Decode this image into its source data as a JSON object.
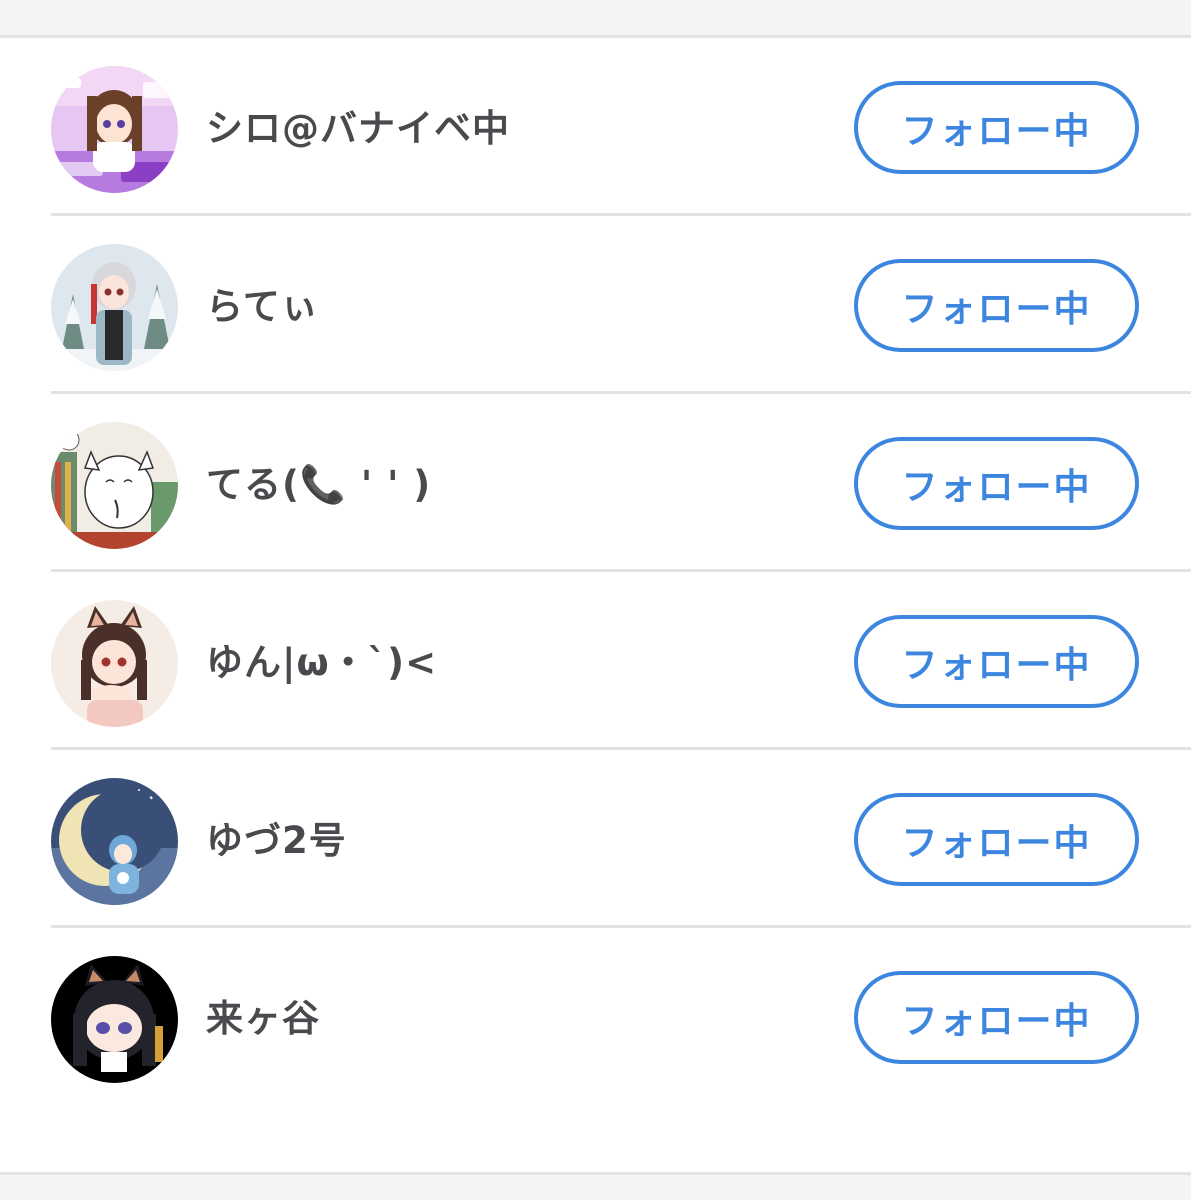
{
  "follow_list": [
    {
      "name": "シロ@バナイベ中",
      "button_label": "フォロー中",
      "avatar": "avatar-maid-girl-purple"
    },
    {
      "name": "らてぃ",
      "button_label": "フォロー中",
      "avatar": "avatar-snow-forest-girl"
    },
    {
      "name": "てる(📞 ' ' )",
      "button_label": "フォロー中",
      "avatar": "avatar-white-cat-sketch"
    },
    {
      "name": "ゆん|ω・`)<",
      "button_label": "フォロー中",
      "avatar": "avatar-cat-ear-girl"
    },
    {
      "name": "ゆづ2号",
      "button_label": "フォロー中",
      "avatar": "avatar-crescent-moon-girl"
    },
    {
      "name": "来ヶ谷",
      "button_label": "フォロー中",
      "avatar": "avatar-black-cat-girl"
    }
  ],
  "colors": {
    "accent": "#3d86e0",
    "text": "#4a4a4e",
    "divider": "#e2e2e6",
    "background": "#f4f4f6"
  }
}
